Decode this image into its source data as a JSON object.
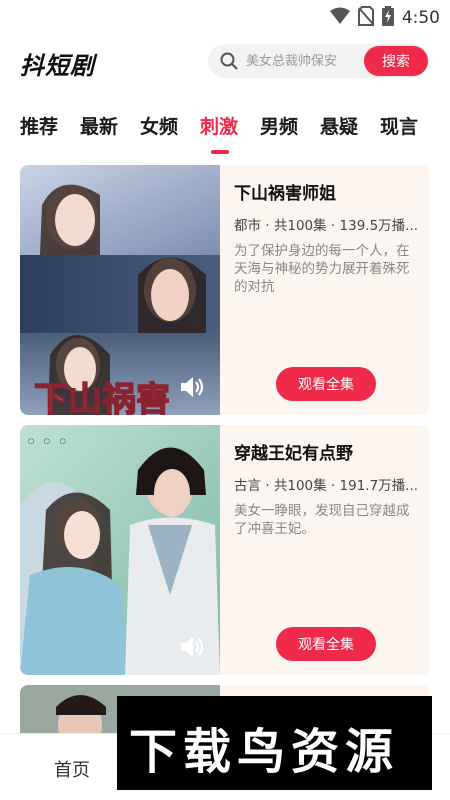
{
  "status_bar": {
    "time": "4:50",
    "icons": [
      "wifi-icon",
      "no-sim-icon",
      "battery-charging-icon"
    ]
  },
  "header": {
    "app_title": "抖短剧",
    "search": {
      "placeholder": "美女总裁帅保安",
      "button_label": "搜索"
    }
  },
  "tabs": [
    {
      "label": "推荐"
    },
    {
      "label": "最新"
    },
    {
      "label": "女频"
    },
    {
      "label": "刺激",
      "active": true
    },
    {
      "label": "男频"
    },
    {
      "label": "悬疑"
    },
    {
      "label": "现言"
    }
  ],
  "dramas": [
    {
      "title": "下山祸害师姐",
      "meta": "都市 · 共100集 · 139.5万播...",
      "description": "为了保护身边的每一个人，在天海与神秘的势力展开着殊死的对抗",
      "poster_text": "下山祸害",
      "watch_label": "观看全集"
    },
    {
      "title": "穿越王妃有点野",
      "meta": "古言 · 共100集 · 191.7万播...",
      "description": "美女一睁眼，发现自己穿越成了冲喜王妃。",
      "watch_label": "观看全集"
    }
  ],
  "bottom_nav": {
    "home_label": "首页"
  },
  "watermark": {
    "text": "下载鸟资源"
  },
  "colors": {
    "accent": "#ef2a4a",
    "card_bg": "#fdf6f0"
  }
}
